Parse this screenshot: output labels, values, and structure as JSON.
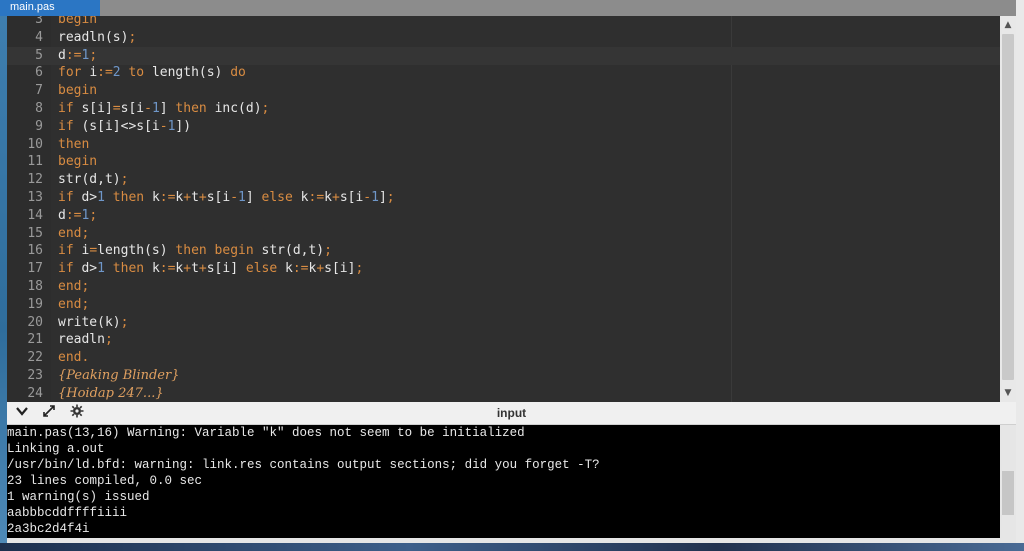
{
  "tab": {
    "label": "main.pas"
  },
  "editor": {
    "lines": [
      {
        "n": "3",
        "tokens": [
          [
            "kw",
            "begin"
          ]
        ]
      },
      {
        "n": "4",
        "tokens": [
          [
            "pl",
            "readln(s)"
          ],
          [
            "kw",
            ";"
          ]
        ]
      },
      {
        "n": "5",
        "tokens": [
          [
            "pl",
            "d"
          ],
          [
            "kw",
            ":="
          ],
          [
            "num",
            "1"
          ],
          [
            "kw",
            ";"
          ]
        ]
      },
      {
        "n": "6",
        "tokens": [
          [
            "kw",
            "for "
          ],
          [
            "pl",
            "i"
          ],
          [
            "kw",
            ":="
          ],
          [
            "num",
            "2"
          ],
          [
            "kw",
            " to "
          ],
          [
            "pl",
            "length(s)"
          ],
          [
            "kw",
            " do"
          ]
        ]
      },
      {
        "n": "7",
        "tokens": [
          [
            "kw",
            "begin"
          ]
        ]
      },
      {
        "n": "8",
        "tokens": [
          [
            "kw",
            "if "
          ],
          [
            "pl",
            "s[i]"
          ],
          [
            "kw",
            "="
          ],
          [
            "pl",
            "s[i"
          ],
          [
            "kw",
            "-"
          ],
          [
            "num",
            "1"
          ],
          [
            "pl",
            "]"
          ],
          [
            "kw",
            " then "
          ],
          [
            "pl",
            "inc(d)"
          ],
          [
            "kw",
            ";"
          ]
        ]
      },
      {
        "n": "9",
        "tokens": [
          [
            "kw",
            "if "
          ],
          [
            "pl",
            "(s[i]<>s[i"
          ],
          [
            "kw",
            "-"
          ],
          [
            "num",
            "1"
          ],
          [
            "pl",
            "])"
          ]
        ]
      },
      {
        "n": "10",
        "tokens": [
          [
            "kw",
            "then"
          ]
        ]
      },
      {
        "n": "11",
        "tokens": [
          [
            "kw",
            "begin"
          ]
        ]
      },
      {
        "n": "12",
        "tokens": [
          [
            "pl",
            "str(d,t)"
          ],
          [
            "kw",
            ";"
          ]
        ]
      },
      {
        "n": "13",
        "tokens": [
          [
            "kw",
            "if "
          ],
          [
            "pl",
            "d>"
          ],
          [
            "num",
            "1"
          ],
          [
            "kw",
            " then "
          ],
          [
            "pl",
            "k"
          ],
          [
            "kw",
            ":="
          ],
          [
            "pl",
            "k"
          ],
          [
            "kw",
            "+"
          ],
          [
            "pl",
            "t"
          ],
          [
            "kw",
            "+"
          ],
          [
            "pl",
            "s[i"
          ],
          [
            "kw",
            "-"
          ],
          [
            "num",
            "1"
          ],
          [
            "pl",
            "]"
          ],
          [
            "kw",
            " else "
          ],
          [
            "pl",
            "k"
          ],
          [
            "kw",
            ":="
          ],
          [
            "pl",
            "k"
          ],
          [
            "kw",
            "+"
          ],
          [
            "pl",
            "s[i"
          ],
          [
            "kw",
            "-"
          ],
          [
            "num",
            "1"
          ],
          [
            "pl",
            "]"
          ],
          [
            "kw",
            ";"
          ]
        ]
      },
      {
        "n": "14",
        "tokens": [
          [
            "pl",
            "d"
          ],
          [
            "kw",
            ":="
          ],
          [
            "num",
            "1"
          ],
          [
            "kw",
            ";"
          ]
        ]
      },
      {
        "n": "15",
        "tokens": [
          [
            "kw",
            "end;"
          ]
        ]
      },
      {
        "n": "16",
        "tokens": [
          [
            "kw",
            "if "
          ],
          [
            "pl",
            "i"
          ],
          [
            "kw",
            "="
          ],
          [
            "pl",
            "length(s)"
          ],
          [
            "kw",
            " then begin "
          ],
          [
            "pl",
            "str(d,t)"
          ],
          [
            "kw",
            ";"
          ]
        ]
      },
      {
        "n": "17",
        "tokens": [
          [
            "kw",
            "if "
          ],
          [
            "pl",
            "d>"
          ],
          [
            "num",
            "1"
          ],
          [
            "kw",
            " then "
          ],
          [
            "pl",
            "k"
          ],
          [
            "kw",
            ":="
          ],
          [
            "pl",
            "k"
          ],
          [
            "kw",
            "+"
          ],
          [
            "pl",
            "t"
          ],
          [
            "kw",
            "+"
          ],
          [
            "pl",
            "s[i]"
          ],
          [
            "kw",
            " else "
          ],
          [
            "pl",
            "k"
          ],
          [
            "kw",
            ":="
          ],
          [
            "pl",
            "k"
          ],
          [
            "kw",
            "+"
          ],
          [
            "pl",
            "s[i]"
          ],
          [
            "kw",
            ";"
          ]
        ]
      },
      {
        "n": "18",
        "tokens": [
          [
            "kw",
            "end;"
          ]
        ]
      },
      {
        "n": "19",
        "tokens": [
          [
            "kw",
            "end;"
          ]
        ]
      },
      {
        "n": "20",
        "tokens": [
          [
            "pl",
            "write(k)"
          ],
          [
            "kw",
            ";"
          ]
        ]
      },
      {
        "n": "21",
        "tokens": [
          [
            "pl",
            "readln"
          ],
          [
            "kw",
            ";"
          ]
        ]
      },
      {
        "n": "22",
        "tokens": [
          [
            "kw",
            "end."
          ]
        ]
      },
      {
        "n": "23",
        "tokens": [
          [
            "cm",
            "{Peaking Blinder}"
          ]
        ]
      },
      {
        "n": "24",
        "tokens": [
          [
            "cm",
            "{Hoidap 247...}"
          ]
        ]
      }
    ],
    "current_line": "5"
  },
  "toolbar": {
    "collapse_icon": "chevron-down-icon",
    "expand_icon": "expand-arrows-icon",
    "settings_icon": "gear-icon",
    "title": "input"
  },
  "console": {
    "lines": [
      "main.pas(13,16) Warning: Variable \"k\" does not seem to be initialized",
      "Linking a.out",
      "/usr/bin/ld.bfd: warning: link.res contains output sections; did you forget -T?",
      "23 lines compiled, 0.0 sec",
      "1 warning(s) issued",
      "aabbbcddffffiiii",
      "2a3bc2d4f4i"
    ]
  },
  "colors": {
    "keyword": "#d98c42",
    "number": "#6f97c9",
    "plain": "#e6e6e6",
    "tab": "#2b76c4"
  }
}
